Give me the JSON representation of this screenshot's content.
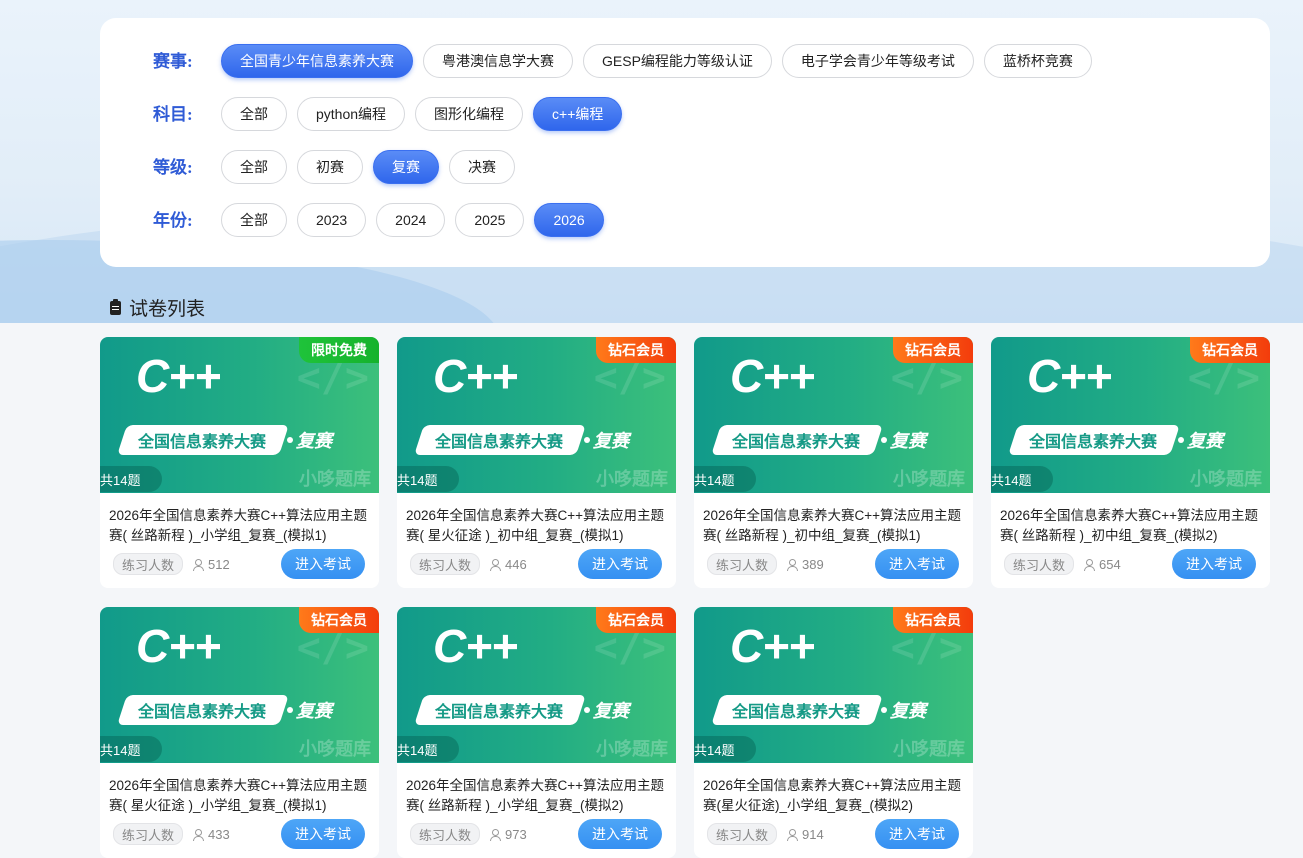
{
  "filters": {
    "event": {
      "label": "赛事:",
      "options": [
        "全国青少年信息素养大赛",
        "粤港澳信息学大赛",
        "GESP编程能力等级认证",
        "电子学会青少年等级考试",
        "蓝桥杯竞赛"
      ],
      "selected": "全国青少年信息素养大赛"
    },
    "subject": {
      "label": "科目:",
      "options": [
        "全部",
        "python编程",
        "图形化编程",
        "c++编程"
      ],
      "selected": "c++编程"
    },
    "level": {
      "label": "等级:",
      "options": [
        "全部",
        "初赛",
        "复赛",
        "决赛"
      ],
      "selected": "复赛"
    },
    "year": {
      "label": "年份:",
      "options": [
        "全部",
        "2023",
        "2024",
        "2025",
        "2026"
      ],
      "selected": "2026"
    }
  },
  "list": {
    "title": "试卷列表",
    "practice_label": "练习人数",
    "enter_label": "进入考试",
    "cover": {
      "language": "C++",
      "contest": "全国信息素养大赛",
      "stage": "复赛",
      "watermark": "小哆题库"
    },
    "colors": {
      "accent": "#2f66ec",
      "badge_free": "#15b22c",
      "badge_vip": "#f33c0c",
      "enter": "#3590f2"
    },
    "cards": [
      {
        "badge": "限时免费",
        "badge_type": "free",
        "count": "共14题",
        "title": "2026年全国信息素养大赛C++算法应用主题赛( 丝路新程 )_小学组_复赛_(模拟1)",
        "practice": "512"
      },
      {
        "badge": "钻石会员",
        "badge_type": "vip",
        "count": "共14题",
        "title": "2026年全国信息素养大赛C++算法应用主题赛( 星火征途 )_初中组_复赛_(模拟1)",
        "practice": "446"
      },
      {
        "badge": "钻石会员",
        "badge_type": "vip",
        "count": "共14题",
        "title": "2026年全国信息素养大赛C++算法应用主题赛( 丝路新程 )_初中组_复赛_(模拟1)",
        "practice": "389"
      },
      {
        "badge": "钻石会员",
        "badge_type": "vip",
        "count": "共14题",
        "title": "2026年全国信息素养大赛C++算法应用主题赛( 丝路新程 )_初中组_复赛_(模拟2)",
        "practice": "654"
      },
      {
        "badge": "钻石会员",
        "badge_type": "vip",
        "count": "共14题",
        "title": "2026年全国信息素养大赛C++算法应用主题赛( 星火征途 )_小学组_复赛_(模拟1)",
        "practice": "433"
      },
      {
        "badge": "钻石会员",
        "badge_type": "vip",
        "count": "共14题",
        "title": "2026年全国信息素养大赛C++算法应用主题赛( 丝路新程 )_小学组_复赛_(模拟2)",
        "practice": "973"
      },
      {
        "badge": "钻石会员",
        "badge_type": "vip",
        "count": "共14题",
        "title": "2026年全国信息素养大赛C++算法应用主题赛(星火征途)_小学组_复赛_(模拟2)",
        "practice": "914"
      }
    ]
  }
}
